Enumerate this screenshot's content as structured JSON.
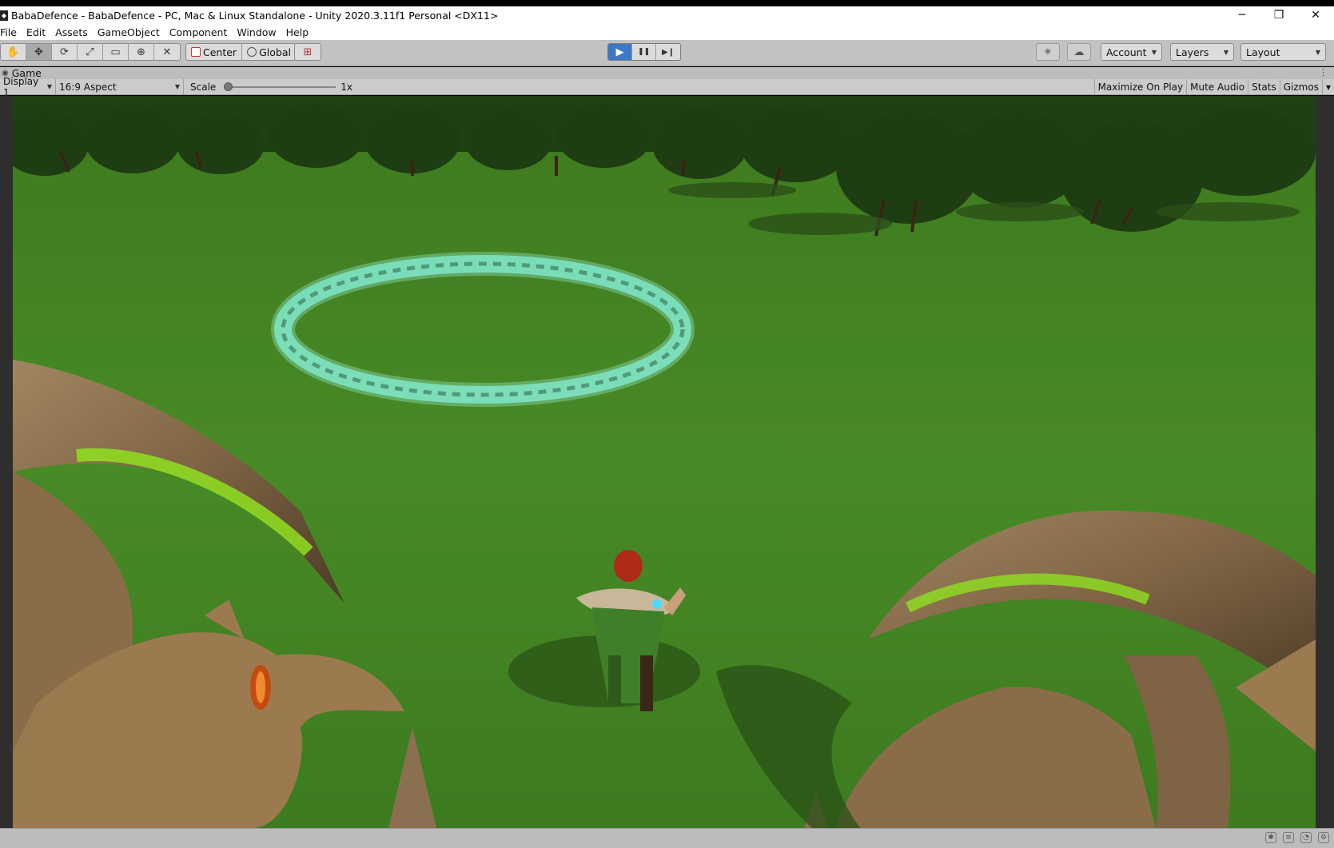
{
  "window": {
    "app_icon": "unity-logo-icon",
    "title": "BabaDefence - BabaDefence - PC, Mac & Linux Standalone - Unity 2020.3.11f1 Personal <DX11>",
    "controls": {
      "minimize": "─",
      "restore": "❐",
      "close": "✕"
    }
  },
  "menu": {
    "items": [
      "File",
      "Edit",
      "Assets",
      "GameObject",
      "Component",
      "Window",
      "Help"
    ]
  },
  "toolbar": {
    "transform_tools": [
      "hand-tool-icon",
      "move-tool-icon",
      "rotate-tool-icon",
      "scale-tool-icon",
      "rect-tool-icon",
      "transform-tool-icon",
      "custom-tool-icon"
    ],
    "active_tool": "move-tool-icon",
    "pivot_label": "Center",
    "space_label": "Global",
    "playback": {
      "play": "▶",
      "pause": "❚❚",
      "step": "▶❙",
      "playing": true
    },
    "account_label": "Account",
    "layers_label": "Layers",
    "layout_label": "Layout",
    "accent_color": "#3b78c8"
  },
  "game_tab": {
    "label": "Game",
    "menu_glyph": "⋮"
  },
  "game_toolbar": {
    "display": "Display 1",
    "aspect": "16:9 Aspect",
    "scale_label": "Scale",
    "scale_value": "1x",
    "toggles": [
      "Maximize On Play",
      "Mute Audio",
      "Stats",
      "Gizmos"
    ],
    "gizmos_arrow": "▾"
  },
  "scene": {
    "ground_color": "#3f7d1f",
    "rune_circle_color": "#7fe6c8",
    "character": "red-haired ranger with cape"
  }
}
